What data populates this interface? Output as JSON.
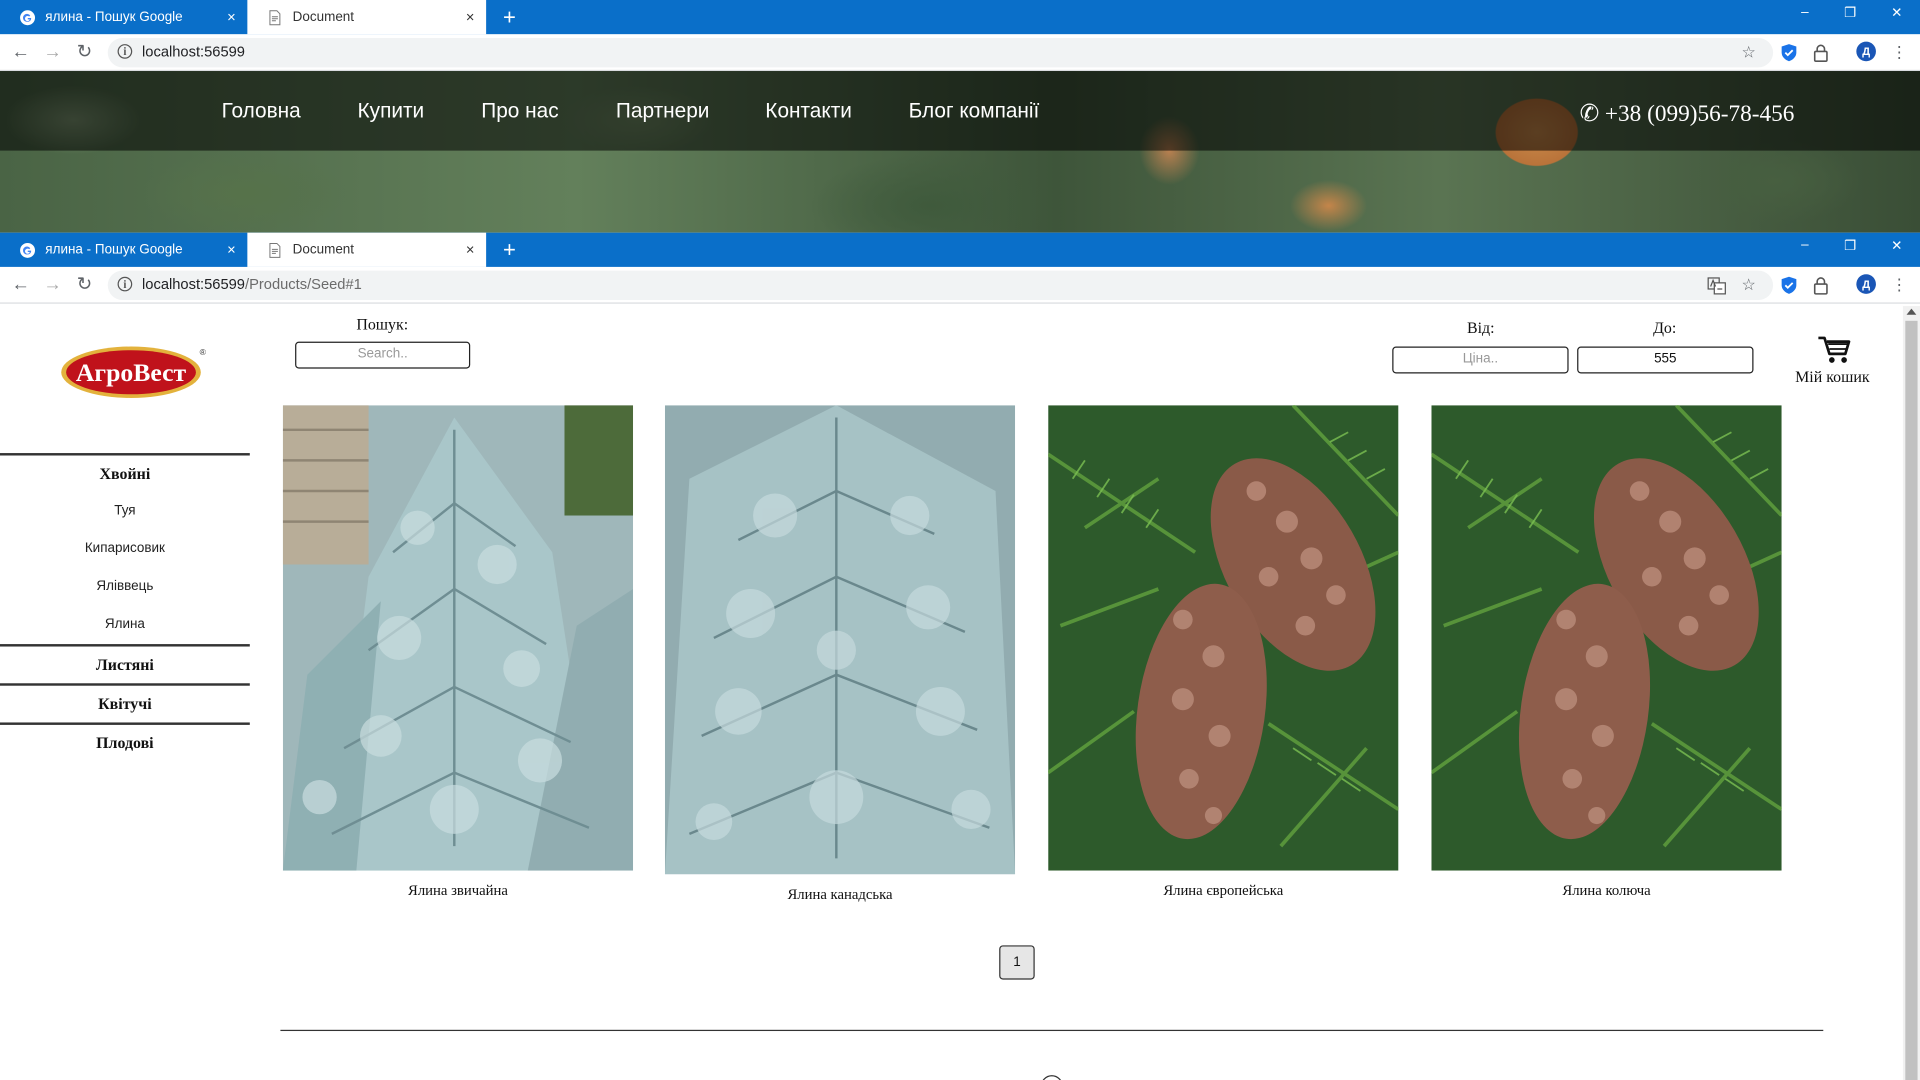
{
  "browser_back": {
    "tabs": [
      {
        "label": "ялина - Пошук Google",
        "close": "×"
      },
      {
        "label": "Document",
        "close": "×"
      }
    ],
    "new_tab": "+",
    "window": {
      "minimize": "–",
      "restore": "❐",
      "close": "✕"
    },
    "url_host": "localhost:56599",
    "url_path": ""
  },
  "browser_front": {
    "tabs": [
      {
        "label": "ялина - Пошук Google",
        "close": "×"
      },
      {
        "label": "Document",
        "close": "×"
      }
    ],
    "new_tab": "+",
    "window": {
      "minimize": "–",
      "restore": "❐",
      "close": "✕"
    },
    "url_host": "localhost:56599",
    "url_path": "/Products/Seed#1"
  },
  "nav": {
    "items": [
      "Головна",
      "Купити",
      "Про нас",
      "Партнери",
      "Контакти",
      "Блог компанії"
    ],
    "phone": "+38 (099)56-78-456"
  },
  "logo": {
    "text": "АгроВест",
    "mark": "®"
  },
  "search": {
    "label": "Пошук:",
    "placeholder": "Search.."
  },
  "price_filter": {
    "from_label": "Від:",
    "to_label": "До:",
    "from_placeholder": "Ціна..",
    "to_value": "555"
  },
  "cart": {
    "label": "Мій кошик"
  },
  "categories": [
    {
      "title": "Хвойні",
      "items": [
        "Туя",
        "Кипарисовик",
        "Яліввець",
        "Ялина"
      ]
    },
    {
      "title": "Листяні",
      "items": []
    },
    {
      "title": "Квітучі",
      "items": []
    },
    {
      "title": "Плодові",
      "items": []
    }
  ],
  "products": [
    {
      "name": "Ялина звичайна",
      "image": "blue-spruce-tree"
    },
    {
      "name": "Ялина канадська",
      "image": "blue-spruce-tree"
    },
    {
      "name": "Ялина європейська",
      "image": "spruce-cones"
    },
    {
      "name": "Ялина колюча",
      "image": "spruce-cones"
    }
  ],
  "pagination": {
    "current": "1"
  },
  "colors": {
    "tab_bar": "#0a6fc9",
    "logo_red": "#c0121b",
    "logo_gold": "#e3b23c"
  }
}
